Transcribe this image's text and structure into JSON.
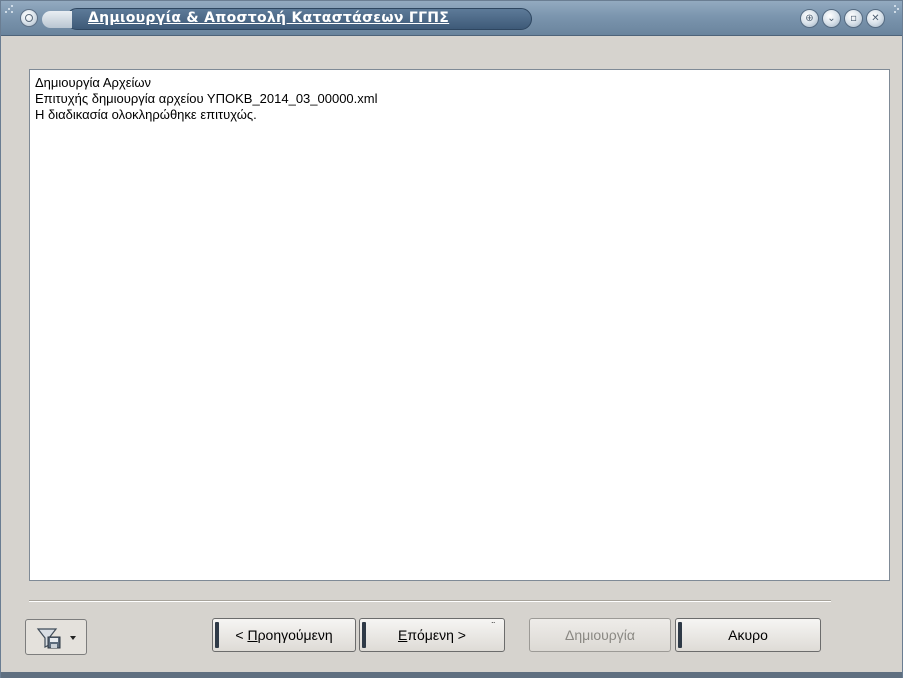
{
  "window": {
    "title": "Δημιουργία & Αποστολή Καταστάσεων ΓΓΠΣ"
  },
  "title_icons": {
    "menu": "circle-menu-icon",
    "buttons": [
      "options-icon",
      "minimize-icon",
      "restore-icon",
      "close-icon"
    ]
  },
  "log": {
    "lines": [
      "Δημιουργία Αρχείων",
      "Επιτυχής δημιουργία αρχείου ΥΠΟΚΒ_2014_03_00000.xml",
      "Η διαδικασία ολοκληρώθηκε επιτυχώς."
    ]
  },
  "footer": {
    "filter_icon": "filter-save-icon",
    "prev_prefix": "< ",
    "prev_accel": "Π",
    "prev_rest": "ροηγούμενη",
    "next_accel": "Ε",
    "next_rest": "πόμενη >",
    "create_label": "Δημιουργία",
    "cancel_label": "Ακυρο"
  },
  "colors": {
    "titlebar": "#7b95ae",
    "title_pill": "#4a6685",
    "content_bg": "#ffffff",
    "dialog_bg": "#d6d3ce"
  }
}
